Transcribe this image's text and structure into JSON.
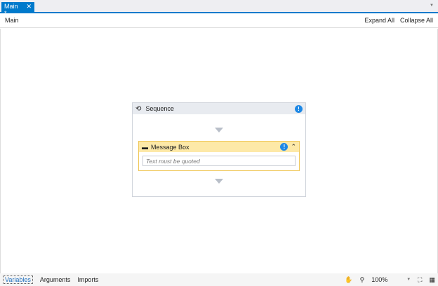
{
  "tab": {
    "label": "Main *",
    "close": "✕"
  },
  "breadcrumb": {
    "path": "Main",
    "expand_all": "Expand All",
    "collapse_all": "Collapse All"
  },
  "sequence": {
    "title": "Sequence",
    "info": "!",
    "message_box": {
      "title": "Message Box",
      "info": "!",
      "collapse": "⌃",
      "placeholder": "Text must be quoted"
    }
  },
  "footer": {
    "tabs": [
      "Variables",
      "Arguments",
      "Imports"
    ],
    "zoom": "100%"
  }
}
